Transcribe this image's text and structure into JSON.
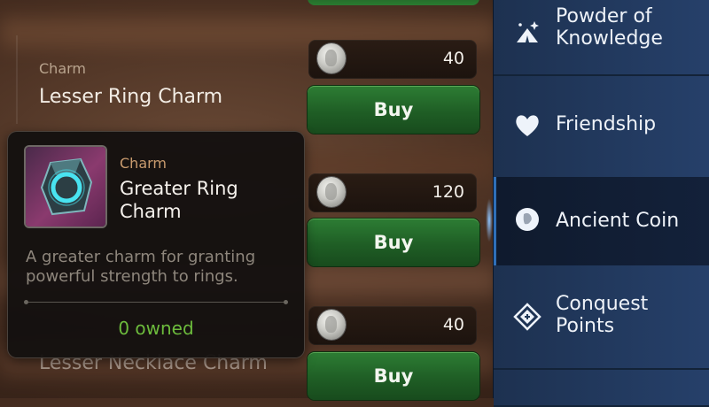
{
  "shop": {
    "items": [
      {
        "category": "Charm",
        "name": "Lesser Ring Charm",
        "price": "40",
        "buy_label": "Buy"
      },
      {
        "category": "",
        "name": "",
        "price": "120",
        "buy_label": "Buy"
      },
      {
        "category": "",
        "name": "Lesser Necklace Charm",
        "price": "40",
        "buy_label": "Buy"
      }
    ],
    "currency_icon": "ancient-coin-icon"
  },
  "tooltip": {
    "category": "Charm",
    "name": "Greater Ring Charm",
    "description": "A greater charm for granting powerful strength to rings.",
    "owned": "0 owned",
    "icon": "greater-ring-charm-icon",
    "owned_color": "#6cbb3c",
    "category_color": "#c99b6e"
  },
  "sidebar": {
    "items": [
      {
        "label": "Powder of Knowledge",
        "icon": "sparkle-tent-icon",
        "active": false
      },
      {
        "label": "Friendship",
        "icon": "heart-icon",
        "active": false
      },
      {
        "label": "Ancient Coin",
        "icon": "ancient-coin-icon",
        "active": true
      },
      {
        "label": "Conquest Points",
        "icon": "conquest-emblem-icon",
        "active": false
      }
    ],
    "accent": "#2f6fb8"
  },
  "colors": {
    "buy_button": "#2d7d34",
    "sidebar_bg": "#1f3554"
  }
}
